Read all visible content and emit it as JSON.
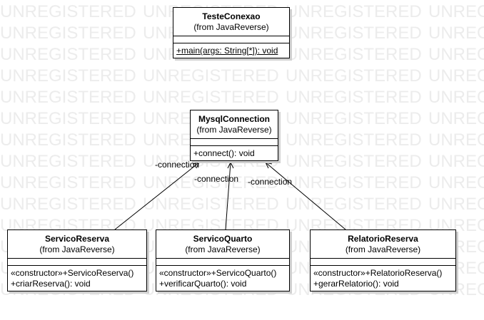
{
  "watermark_text": "UNREGISTERED",
  "classes": {
    "teste_conexao": {
      "name": "TesteConexao",
      "origin": "(from JavaReverse)",
      "operations": [
        "+main(args: String[*]): void"
      ]
    },
    "mysql_connection": {
      "name": "MysqlConnection",
      "origin": "(from JavaReverse)",
      "operations": [
        "+connect(): void"
      ]
    },
    "servico_reserva": {
      "name": "ServicoReserva",
      "origin": "(from JavaReverse)",
      "operations": [
        "«constructor»+ServicoReserva()",
        "+criarReserva(): void"
      ]
    },
    "servico_quarto": {
      "name": "ServicoQuarto",
      "origin": "(from JavaReverse)",
      "operations": [
        "«constructor»+ServicoQuarto()",
        "+verificarQuarto(): void"
      ]
    },
    "relatorio_reserva": {
      "name": "RelatorioReserva",
      "origin": "(from JavaReverse)",
      "operations": [
        "«constructor»+RelatorioReserva()",
        "+gerarRelatorio(): void"
      ]
    }
  },
  "associations": {
    "reserva_role": "-connection",
    "quarto_role": "-connection",
    "relatorio_role": "-connection"
  }
}
